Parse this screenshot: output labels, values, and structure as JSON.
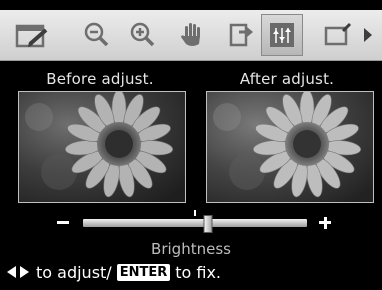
{
  "toolbar": {
    "items": [
      {
        "icon": "edit-icon"
      },
      {
        "icon": "zoom-out-icon"
      },
      {
        "icon": "zoom-in-icon"
      },
      {
        "icon": "pan-hand-icon"
      },
      {
        "icon": "rotate-icon"
      },
      {
        "icon": "adjust-icon",
        "selected": true
      },
      {
        "icon": "frame-icon"
      },
      {
        "icon": "more-arrow-icon"
      }
    ]
  },
  "compare": {
    "before_label": "Before adjust.",
    "after_label": "After adjust."
  },
  "slider": {
    "minus_symbol": "−",
    "plus_symbol": "+",
    "label": "Brightness",
    "value_fraction": 0.56
  },
  "help": {
    "text1": "to adjust/",
    "enter_key": "ENTER",
    "text2": "to fix."
  },
  "colors": {
    "toolbar_bg": "#dcdcdc",
    "icon": "#6e6e6e",
    "background": "#000000"
  }
}
